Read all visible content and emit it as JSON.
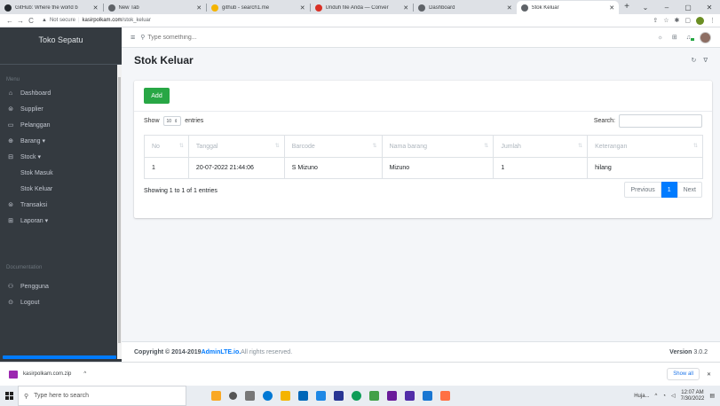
{
  "browser": {
    "tabs": [
      {
        "title": "GitHub: Where the world b",
        "icon": "github-icon",
        "color": "#24292e"
      },
      {
        "title": "New Tab",
        "icon": "chrome-icon",
        "color": "#5f6368"
      },
      {
        "title": "github - search1.me",
        "icon": "search1-icon",
        "color": "#f4b400"
      },
      {
        "title": "Unduh file Anda — Conver",
        "icon": "convert-icon",
        "color": "#d93025"
      },
      {
        "title": "Dashboard",
        "icon": "globe-icon",
        "color": "#5f6368"
      },
      {
        "title": "Stok Keluar",
        "icon": "globe-icon",
        "color": "#5f6368",
        "active": true
      }
    ],
    "new_tab": "+",
    "url_warning": "Not secure",
    "url_host": "kasirpolkam.com",
    "url_path": "/stok_keluar"
  },
  "sidebar": {
    "brand": "Toko Sepatu",
    "menu_header": "Menu",
    "items": [
      {
        "label": "Dashboard",
        "icon": "⌂",
        "name": "dashboard"
      },
      {
        "label": "Supplier",
        "icon": "⊜",
        "name": "supplier"
      },
      {
        "label": "Pelanggan",
        "icon": "▭",
        "name": "pelanggan"
      },
      {
        "label": "Barang ▾",
        "icon": "⊕",
        "name": "barang"
      },
      {
        "label": "Stock ▾",
        "icon": "⊟",
        "name": "stock"
      }
    ],
    "sub_items": [
      {
        "label": "Stok Masuk",
        "name": "stok-masuk"
      },
      {
        "label": "Stok Keluar",
        "name": "stok-keluar"
      }
    ],
    "items2": [
      {
        "label": "Transaksi",
        "icon": "⊜",
        "name": "transaksi"
      },
      {
        "label": "Laporan ▾",
        "icon": "⊞",
        "name": "laporan"
      }
    ],
    "doc_header": "Documentation",
    "items3": [
      {
        "label": "Pengguna",
        "icon": "⚇",
        "name": "pengguna"
      },
      {
        "label": "Logout",
        "icon": "⊙",
        "name": "logout"
      }
    ]
  },
  "topnav": {
    "search_placeholder": "Type something..."
  },
  "page": {
    "title": "Stok Keluar",
    "add_label": "Add",
    "show_label": "Show",
    "length_value": "10",
    "entries_label": "entries",
    "search_label": "Search:",
    "columns": [
      "No",
      "Tanggal",
      "Barcode",
      "Nama barang",
      "Jumlah",
      "Keterangan"
    ],
    "rows": [
      [
        "1",
        "20-07-2022 21:44:06",
        "S Mizuno",
        "Mizuno",
        "1",
        "hilang"
      ]
    ],
    "info": "Showing 1 to 1 of 1 entries",
    "pager": {
      "previous": "Previous",
      "current": "1",
      "next": "Next"
    }
  },
  "footer": {
    "copyright_prefix": "Copyright © 2014-2019 ",
    "brand": "AdminLTE.io.",
    "rights": " All rights reserved.",
    "version_label": "Version",
    "version_value": "3.0.2"
  },
  "downloads": {
    "file": "kasirpolkam.com.zip",
    "show_all": "Show all"
  },
  "taskbar": {
    "search_placeholder": "Type here to search",
    "weather": "Huja...",
    "time": "12:07 AM",
    "date": "7/30/2022"
  }
}
